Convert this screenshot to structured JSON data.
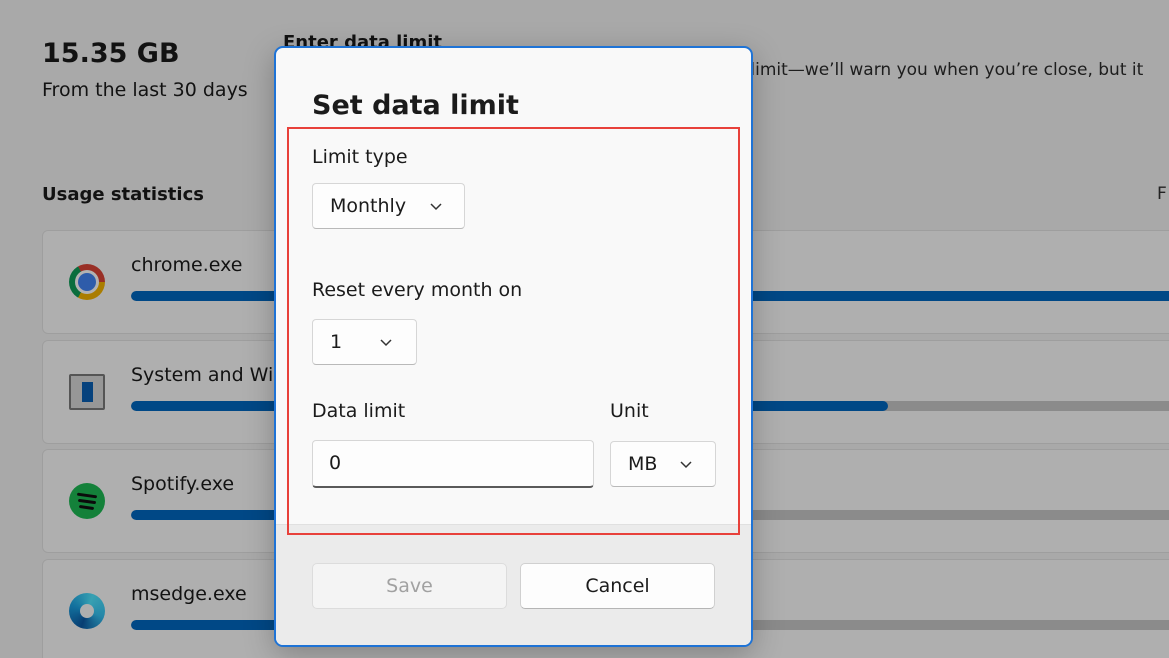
{
  "background": {
    "usage_total": "15.35 GB",
    "usage_period": "From the last 30 days",
    "enter_limit_title": "Enter data limit",
    "enter_limit_desc": "r limit—we’ll warn you when you’re close, but it",
    "section_title": "Usage statistics",
    "filter_label_partial": "F",
    "apps": [
      {
        "name": "chrome.exe",
        "icon": "chrome-icon",
        "usage_fraction": 1.0
      },
      {
        "name": "System and Win",
        "icon": "system-icon",
        "usage_fraction": 0.72
      },
      {
        "name": "Spotify.exe",
        "icon": "spotify-icon",
        "usage_fraction": 0.15
      },
      {
        "name": "msedge.exe",
        "icon": "edge-icon",
        "usage_fraction": 0.15
      }
    ],
    "accent_color": "#0067c0"
  },
  "dialog": {
    "title": "Set data limit",
    "limit_type": {
      "label": "Limit type",
      "value": "Monthly"
    },
    "reset_day": {
      "label": "Reset every month on",
      "value": "1"
    },
    "data_limit": {
      "label": "Data limit",
      "value": "0"
    },
    "unit": {
      "label": "Unit",
      "value": "MB"
    },
    "save_label": "Save",
    "cancel_label": "Cancel",
    "highlight_color": "#e8413b"
  }
}
